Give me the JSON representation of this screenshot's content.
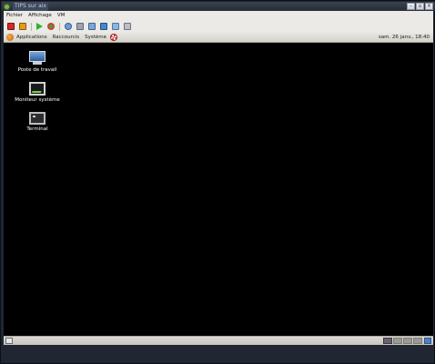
{
  "window": {
    "title": "TIPS sur aix",
    "controls": [
      "minimize",
      "maximize",
      "close"
    ]
  },
  "host_menu": {
    "items": [
      "Fichier",
      "Affichage",
      "VM"
    ]
  },
  "toolbar": {
    "icons": [
      "stop-red-icon",
      "pause-orange-icon",
      "play-green-icon",
      "reset-icon",
      "snapshot-icon",
      "revert-icon",
      "snapshot-manager-icon",
      "fullscreen-icon",
      "quick-switch-icon",
      "send-keys-icon"
    ]
  },
  "guest_panel": {
    "applications": "Applications",
    "shortcuts": "Raccourcis",
    "system": "Système",
    "clock": "sam. 26 janv., 18:40"
  },
  "desktop_icons": [
    {
      "label": "Poste de travail",
      "icon": "computer-icon"
    },
    {
      "label": "Moniteur système",
      "icon": "system-monitor-icon"
    },
    {
      "label": "Terminal",
      "icon": "terminal-icon"
    }
  ],
  "bottom_panel": {
    "workspaces": 4,
    "active_workspace": 1
  },
  "colors": {
    "desktop_bg": "#000000",
    "panel_bg": "#e3e0da",
    "chrome_bg": "#202733"
  }
}
